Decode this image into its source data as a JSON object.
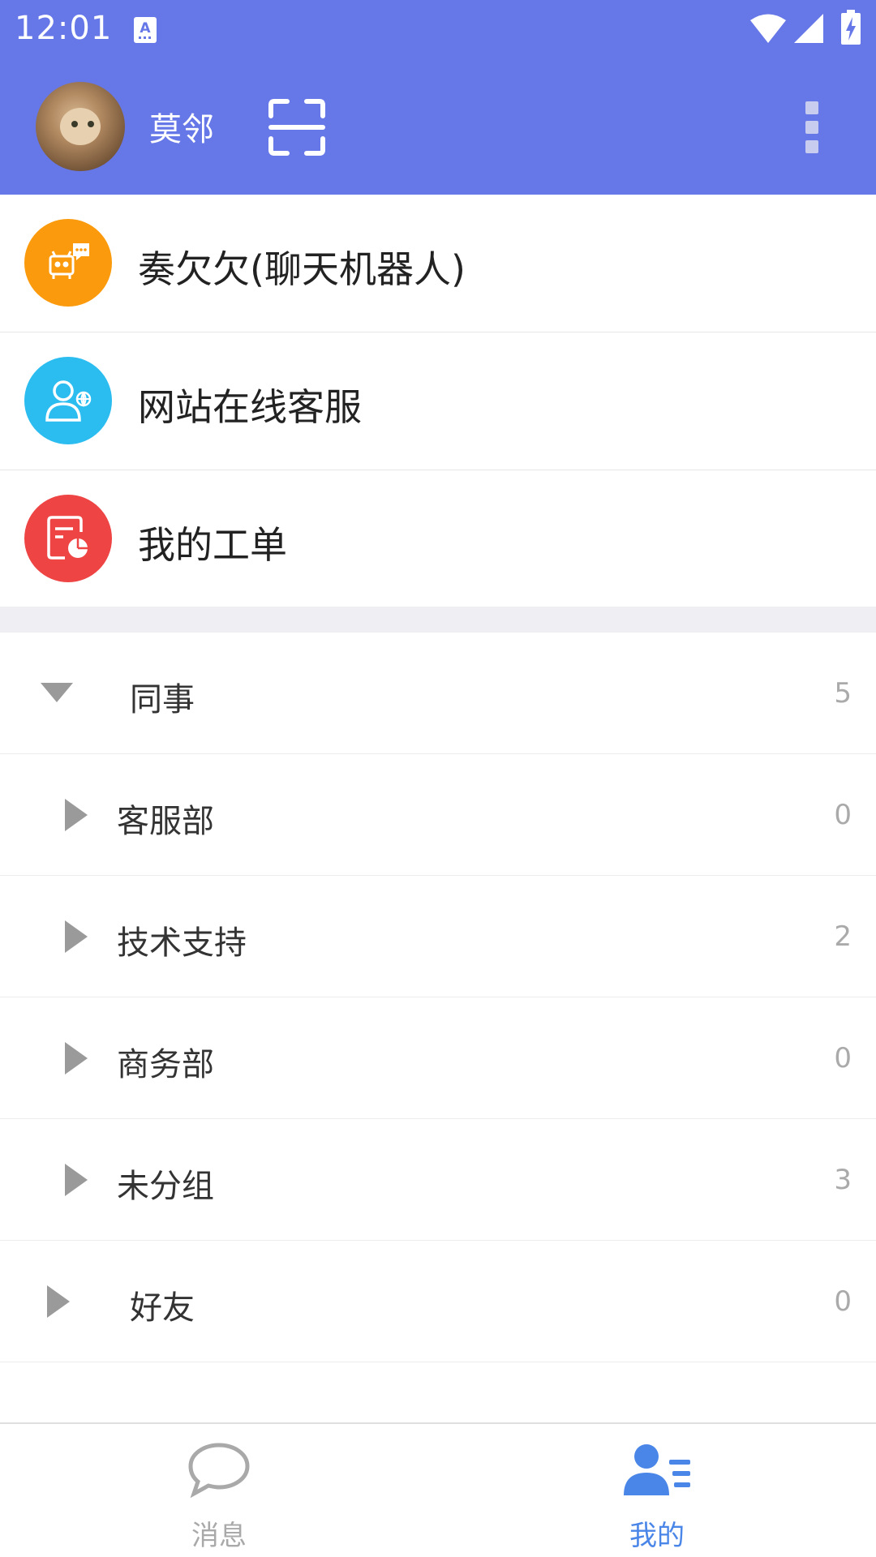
{
  "status_bar": {
    "time": "12:01"
  },
  "header": {
    "user_name": "莫邻"
  },
  "services": [
    {
      "label": "奏欠欠(聊天机器人)",
      "color": "#fb9a0c",
      "icon": "robot-chat-icon"
    },
    {
      "label": "网站在线客服",
      "color": "#2bbcf0",
      "icon": "user-globe-icon"
    },
    {
      "label": "我的工单",
      "color": "#ee4444",
      "icon": "work-order-icon"
    }
  ],
  "groups": [
    {
      "label": "同事",
      "count": "5",
      "expanded": true,
      "level": 0
    },
    {
      "label": "客服部",
      "count": "0",
      "expanded": false,
      "level": 1
    },
    {
      "label": "技术支持",
      "count": "2",
      "expanded": false,
      "level": 1
    },
    {
      "label": "商务部",
      "count": "0",
      "expanded": false,
      "level": 1
    },
    {
      "label": "未分组",
      "count": "3",
      "expanded": false,
      "level": 1
    },
    {
      "label": "好友",
      "count": "0",
      "expanded": false,
      "level": 0
    }
  ],
  "tabs": [
    {
      "label": "消息",
      "active": false,
      "icon": "chat-bubble-icon"
    },
    {
      "label": "我的",
      "active": true,
      "icon": "contacts-icon"
    }
  ],
  "colors": {
    "header_bg": "#6677e8",
    "tab_active": "#4a86e8",
    "tab_inactive": "#a9a9a9"
  }
}
